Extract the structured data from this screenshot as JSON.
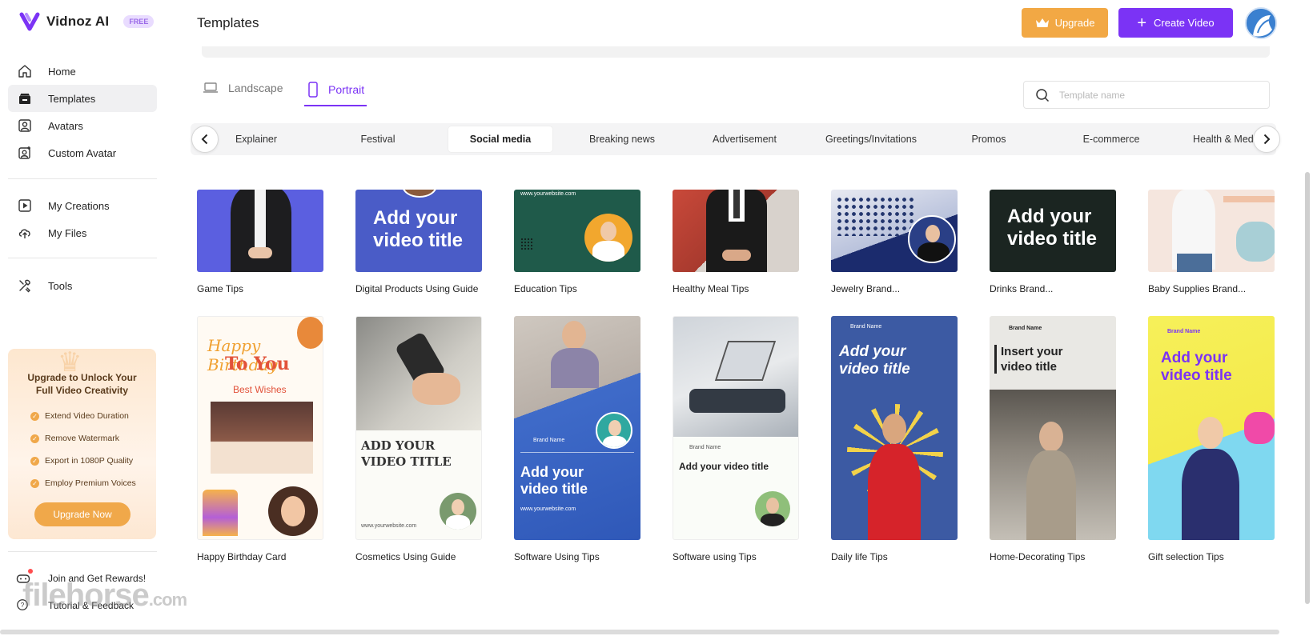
{
  "app": {
    "name": "Vidnoz AI",
    "badge": "FREE"
  },
  "sidebar": {
    "items": [
      {
        "label": "Home",
        "icon": "home-icon"
      },
      {
        "label": "Templates",
        "icon": "templates-icon"
      },
      {
        "label": "Avatars",
        "icon": "avatar-icon"
      },
      {
        "label": "Custom Avatar",
        "icon": "custom-avatar-icon"
      },
      {
        "label": "My Creations",
        "icon": "play-icon"
      },
      {
        "label": "My Files",
        "icon": "upload-cloud-icon"
      },
      {
        "label": "Tools",
        "icon": "tools-icon"
      }
    ],
    "active": "Templates",
    "upgrade_card": {
      "title": "Upgrade to Unlock Your Full Video Creativity",
      "features": [
        "Extend Video Duration",
        "Remove Watermark",
        "Export in 1080P Quality",
        "Employ Premium Voices"
      ],
      "button": "Upgrade Now"
    },
    "bottom_links": [
      {
        "label": "Join and Get Rewards!",
        "icon": "gamepad-icon"
      },
      {
        "label": "Tutorial & Feedback",
        "icon": "help-icon"
      }
    ]
  },
  "watermark": {
    "brand": "filehorse",
    "suffix": ".com"
  },
  "header": {
    "title": "Templates",
    "upgrade": "Upgrade",
    "create": "Create Video"
  },
  "orientation_tabs": [
    {
      "label": "Landscape",
      "icon": "laptop-icon"
    },
    {
      "label": "Portrait",
      "icon": "phone-icon"
    }
  ],
  "orientation_active": "Portrait",
  "search": {
    "placeholder": "Template name",
    "value": ""
  },
  "categories": [
    "Explainer",
    "Festival",
    "Social media",
    "Breaking news",
    "Advertisement",
    "Greetings/Invitations",
    "Promos",
    "E-commerce",
    "Health & Medi"
  ],
  "category_active": "Social media",
  "templates_row1": [
    "Game Tips",
    "Digital Products Using Guide",
    "Education Tips",
    "Healthy Meal Tips",
    "Jewelry Brand...",
    "Drinks Brand...",
    "Baby Supplies Brand..."
  ],
  "templates_row2": [
    "Happy Birthday Card",
    "Cosmetics Using Guide",
    "Software Using Tips",
    "Software using Tips",
    "Daily life Tips",
    "Home-Decorating Tips",
    "Gift selection Tips"
  ],
  "thumb_text": {
    "add_title": "Add your video title",
    "website": "www.yourwebsite.com",
    "birthday_1": "Happy Birthday",
    "birthday_2": "To You",
    "best_wishes": "Best Wishes",
    "add_title_caps": "ADD YOUR VIDEO TITLE",
    "brand": "Brand Name",
    "insert_title": "Insert your video title"
  },
  "colors": {
    "accent": "#7b33f5",
    "upgrade": "#f2a844"
  }
}
